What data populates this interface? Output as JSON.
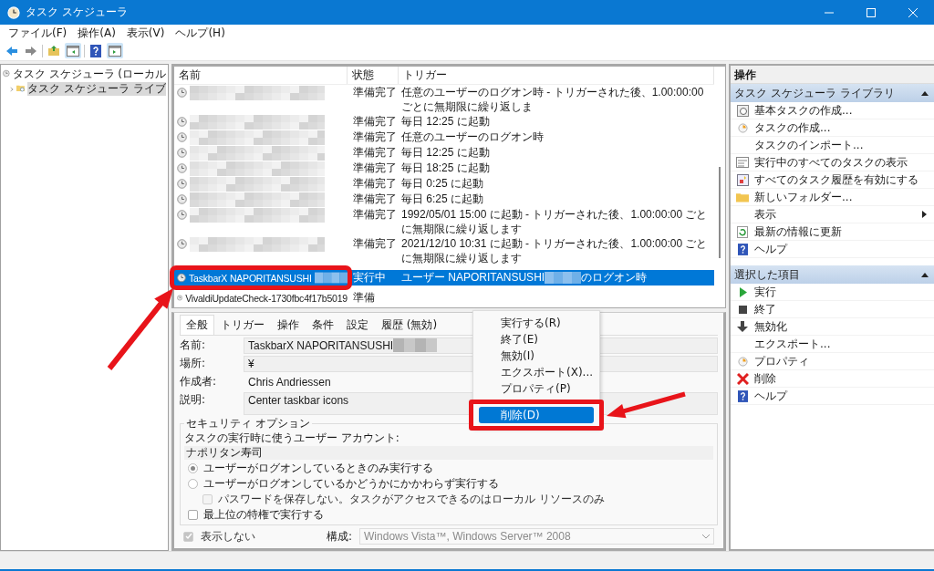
{
  "window": {
    "title": "タスク スケジューラ"
  },
  "menu": [
    {
      "label": "ファイル(F)"
    },
    {
      "label": "操作(A)"
    },
    {
      "label": "表示(V)"
    },
    {
      "label": "ヘルプ(H)"
    }
  ],
  "toolbar": [
    {
      "kind": "back"
    },
    {
      "kind": "forward"
    },
    {
      "kind": "separator"
    },
    {
      "kind": "folder-up"
    },
    {
      "kind": "tree-pane",
      "on": true
    },
    {
      "kind": "separator"
    },
    {
      "kind": "help"
    },
    {
      "kind": "action-pane",
      "on": true
    }
  ],
  "tree": [
    {
      "label": "タスク スケジューラ (ローカル",
      "selected": false,
      "children": [
        {
          "label": "タスク スケジューラ ライブ",
          "selected": true,
          "expanded": false
        }
      ]
    }
  ],
  "tasks": {
    "columns": [
      "名前",
      "状態",
      "トリガー"
    ],
    "rows": [
      {
        "redacted": true,
        "status": "準備完了",
        "trigger": "任意のユーザーのログオン時 - トリガーされた後、1.00:00:00 ごとに無期限に繰り返しま",
        "selected": false
      },
      {
        "redacted": true,
        "status": "準備完了",
        "trigger": "毎日 12:25 に起動",
        "selected": false
      },
      {
        "redacted": true,
        "status": "準備完了",
        "trigger": "任意のユーザーのログオン時",
        "selected": false
      },
      {
        "redacted": true,
        "status": "準備完了",
        "trigger": "毎日 12:25 に起動",
        "selected": false
      },
      {
        "redacted": true,
        "status": "準備完了",
        "trigger": "毎日 18:25 に起動",
        "selected": false
      },
      {
        "redacted": true,
        "status": "準備完了",
        "trigger": "毎日 0:25 に起動",
        "selected": false
      },
      {
        "redacted": true,
        "status": "準備完了",
        "trigger": "毎日 6:25 に起動",
        "selected": false
      },
      {
        "redacted": true,
        "status": "準備完了",
        "trigger": "1992/05/01 15:00 に起動 - トリガーされた後、1.00:00:00 ごとに無期限に繰り返します",
        "selected": false
      },
      {
        "redacted": true,
        "status": "準備完了",
        "trigger": "2021/12/10 10:31 に起動 - トリガーされた後、1.00:00:00 ごとに無期限に繰り返します",
        "selected": false
      },
      {
        "name": "TaskbarX NAPORITANSUSHI",
        "redacted": true,
        "status": "実行中",
        "trigger": "ユーザー NAPORITANSUSHI",
        "trigger_tail": "のログオン時",
        "selected": true
      },
      {
        "name": "VivaldiUpdateCheck-1730fbc4f17b5019",
        "status": "準備",
        "selected": false
      }
    ]
  },
  "context_menu": [
    {
      "label": "実行する(R)",
      "selected": false
    },
    {
      "label": "終了(E)",
      "selected": false
    },
    {
      "label": "無効(I)",
      "selected": false
    },
    {
      "label": "エクスポート(X)...",
      "selected": false
    },
    {
      "label": "プロパティ(P)",
      "selected": false
    },
    {
      "label": "削除(D)",
      "selected": true
    }
  ],
  "details": {
    "tabs": [
      {
        "label": "全般",
        "selected": true
      },
      {
        "label": "トリガー",
        "selected": false
      },
      {
        "label": "操作",
        "selected": false
      },
      {
        "label": "条件",
        "selected": false
      },
      {
        "label": "設定",
        "selected": false
      },
      {
        "label": "履歴 (無効)",
        "selected": false
      }
    ],
    "fields": [
      {
        "kind": "box",
        "label": "名前:",
        "value": "TaskbarX NAPORITANSUSHI",
        "redacted": true
      },
      {
        "kind": "readonly",
        "label": "場所:",
        "value": "¥"
      },
      {
        "kind": "plain",
        "label": "作成者:",
        "value": "Chris Andriessen"
      },
      {
        "kind": "textarea",
        "label": "説明:",
        "value": "Center taskbar icons"
      }
    ],
    "security": {
      "title": "セキュリティ オプション",
      "account_label": "タスクの実行時に使うユーザー アカウント:",
      "account": "ナポリタン寿司",
      "options": [
        {
          "kind": "radio",
          "label": "ユーザーがログオンしているときのみ実行する",
          "selected": true
        },
        {
          "kind": "radio",
          "label": "ユーザーがログオンしているかどうかにかかわらず実行する",
          "selected": false,
          "children": [
            {
              "kind": "checkbox",
              "label": "パスワードを保存しない。タスクがアクセスできるのはローカル リソースのみ",
              "checked": false,
              "disabled": true
            }
          ]
        },
        {
          "kind": "checkbox",
          "label": "最上位の特権で実行する",
          "checked": false
        }
      ]
    },
    "hidden": {
      "label": "表示しない",
      "checked": true,
      "disabled": true
    },
    "config": {
      "label": "構成:",
      "value": "Windows Vista™, Windows Server™ 2008",
      "disabled": true
    }
  },
  "actions": {
    "title": "操作",
    "sections": [
      {
        "title": "タスク スケジューラ ライブラリ",
        "expanded": true,
        "items": [
          {
            "kind": "wizard",
            "label": "基本タスクの作成..."
          },
          {
            "kind": "task",
            "label": "タスクの作成..."
          },
          {
            "kind": "plain",
            "label": "タスクのインポート..."
          },
          {
            "kind": "list",
            "label": "実行中のすべてのタスクの表示"
          },
          {
            "kind": "history",
            "label": "すべてのタスク履歴を有効にする"
          },
          {
            "kind": "folder",
            "label": "新しいフォルダー..."
          },
          {
            "kind": "submenu",
            "label": "表示"
          },
          {
            "kind": "refresh",
            "label": "最新の情報に更新"
          },
          {
            "kind": "help",
            "label": "ヘルプ"
          }
        ]
      },
      {
        "title": "選択した項目",
        "expanded": true,
        "items": [
          {
            "kind": "run",
            "label": "実行"
          },
          {
            "kind": "stop",
            "label": "終了"
          },
          {
            "kind": "disable",
            "label": "無効化"
          },
          {
            "kind": "plain",
            "label": "エクスポート..."
          },
          {
            "kind": "task",
            "label": "プロパティ"
          },
          {
            "kind": "delete",
            "label": "削除"
          },
          {
            "kind": "help",
            "label": "ヘルプ"
          }
        ]
      }
    ]
  }
}
